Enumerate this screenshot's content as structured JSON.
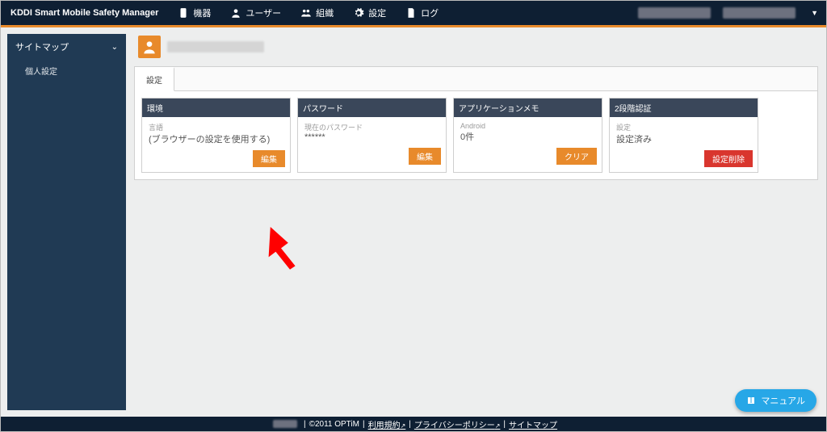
{
  "brand": "KDDI Smart Mobile Safety Manager",
  "nav": {
    "devices": "機器",
    "users": "ユーザー",
    "orgs": "組織",
    "settings": "設定",
    "logs": "ログ"
  },
  "sidebar": {
    "title": "サイトマップ",
    "items": [
      "個人設定"
    ]
  },
  "tabs": {
    "settings": "設定"
  },
  "cards": {
    "env": {
      "title": "環境",
      "label": "言語",
      "value": "(ブラウザーの設定を使用する)",
      "button": "編集"
    },
    "password": {
      "title": "パスワード",
      "label": "現在のパスワード",
      "value": "******",
      "button": "編集"
    },
    "appmemo": {
      "title": "アプリケーションメモ",
      "label": "Android",
      "value": "0件",
      "button": "クリア"
    },
    "twofa": {
      "title": "2段階認証",
      "label": "設定",
      "value": "設定済み",
      "button": "設定削除"
    }
  },
  "manual": "マニュアル",
  "footer": {
    "copyright": "©2011 OPTiM",
    "tos": "利用規約",
    "privacy": "プライバシーポリシー",
    "sitemap": "サイトマップ"
  }
}
